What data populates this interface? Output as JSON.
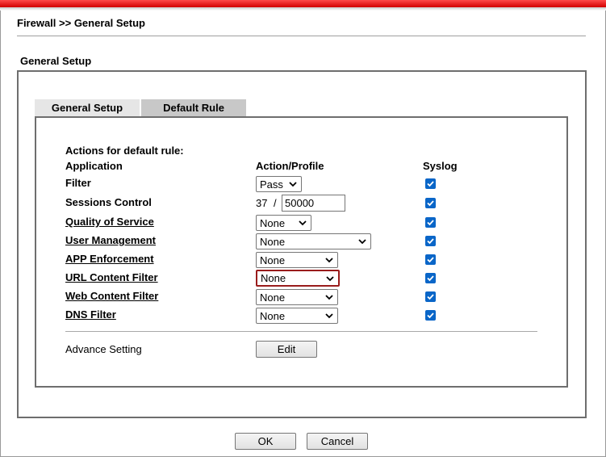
{
  "header": {
    "breadcrumb": "Firewall >> General Setup"
  },
  "section_title": "General Setup",
  "tabs": [
    {
      "label": "General Setup",
      "active": false
    },
    {
      "label": "Default Rule",
      "active": true
    }
  ],
  "rule": {
    "actions_heading": "Actions for default rule:",
    "columns": {
      "application": "Application",
      "action": "Action/Profile",
      "syslog": "Syslog"
    },
    "filter": {
      "label": "Filter",
      "value": "Pass",
      "syslog": true
    },
    "sessions": {
      "label": "Sessions Control",
      "current": "37",
      "separator": "/",
      "max": "50000",
      "syslog": true
    },
    "qos": {
      "label": "Quality of Service",
      "value": "None",
      "syslog": true
    },
    "user_mgmt": {
      "label": "User Management",
      "value": "None",
      "syslog": true
    },
    "app_enforcement": {
      "label": "APP Enforcement",
      "value": "None",
      "syslog": true
    },
    "url_filter": {
      "label": "URL Content Filter",
      "value": "None",
      "syslog": true
    },
    "web_filter": {
      "label": "Web Content Filter",
      "value": "None",
      "syslog": true
    },
    "dns_filter": {
      "label": "DNS Filter",
      "value": "None",
      "syslog": true
    },
    "advance": {
      "label": "Advance Setting",
      "button": "Edit"
    }
  },
  "footer": {
    "ok": "OK",
    "cancel": "Cancel"
  },
  "colors": {
    "accent_red": "#d20000",
    "checkbox_blue": "#0a66c8",
    "focus_border": "#9a1c1c"
  }
}
